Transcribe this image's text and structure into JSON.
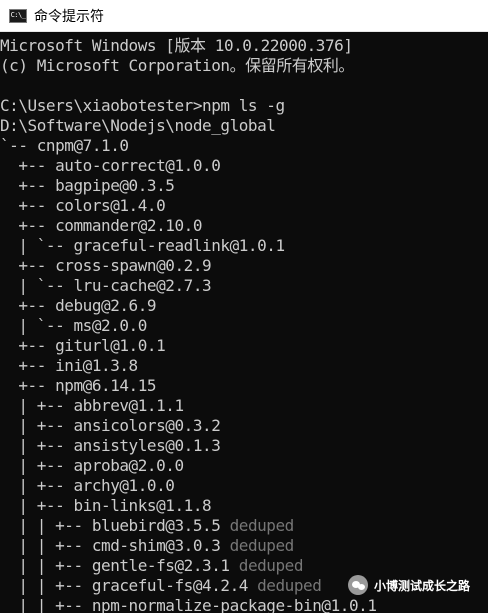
{
  "window": {
    "title": "命令提示符",
    "icon_label": "C:\\_",
    "icon_name": "cmd-icon"
  },
  "console_lines": [
    {
      "text": "Microsoft Windows [版本 10.0.22000.376]",
      "dim": ""
    },
    {
      "text": "(c) Microsoft Corporation。保留所有权利。",
      "dim": ""
    },
    {
      "text": "",
      "dim": ""
    },
    {
      "text": "C:\\Users\\xiaobotester>npm ls -g",
      "dim": ""
    },
    {
      "text": "D:\\Software\\Nodejs\\node_global",
      "dim": ""
    },
    {
      "text": "`-- cnpm@7.1.0",
      "dim": ""
    },
    {
      "text": "  +-- auto-correct@1.0.0",
      "dim": ""
    },
    {
      "text": "  +-- bagpipe@0.3.5",
      "dim": ""
    },
    {
      "text": "  +-- colors@1.4.0",
      "dim": ""
    },
    {
      "text": "  +-- commander@2.10.0",
      "dim": ""
    },
    {
      "text": "  | `-- graceful-readlink@1.0.1",
      "dim": ""
    },
    {
      "text": "  +-- cross-spawn@0.2.9",
      "dim": ""
    },
    {
      "text": "  | `-- lru-cache@2.7.3",
      "dim": ""
    },
    {
      "text": "  +-- debug@2.6.9",
      "dim": ""
    },
    {
      "text": "  | `-- ms@2.0.0",
      "dim": ""
    },
    {
      "text": "  +-- giturl@1.0.1",
      "dim": ""
    },
    {
      "text": "  +-- ini@1.3.8",
      "dim": ""
    },
    {
      "text": "  +-- npm@6.14.15",
      "dim": ""
    },
    {
      "text": "  | +-- abbrev@1.1.1",
      "dim": ""
    },
    {
      "text": "  | +-- ansicolors@0.3.2",
      "dim": ""
    },
    {
      "text": "  | +-- ansistyles@0.1.3",
      "dim": ""
    },
    {
      "text": "  | +-- aproba@2.0.0",
      "dim": ""
    },
    {
      "text": "  | +-- archy@1.0.0",
      "dim": ""
    },
    {
      "text": "  | +-- bin-links@1.1.8",
      "dim": ""
    },
    {
      "text": "  | | +-- bluebird@3.5.5",
      "dim": " deduped"
    },
    {
      "text": "  | | +-- cmd-shim@3.0.3",
      "dim": " deduped"
    },
    {
      "text": "  | | +-- gentle-fs@2.3.1",
      "dim": " deduped"
    },
    {
      "text": "  | | +-- graceful-fs@4.2.4",
      "dim": " deduped"
    },
    {
      "text": "  | | +-- npm-normalize-package-bin@1.0.1",
      "dim": ""
    }
  ],
  "watermark": {
    "text": "小博测试成长之路",
    "icon_name": "wechat-icon"
  },
  "colors": {
    "console_background": "#0c0c0c",
    "console_text": "#cccccc",
    "deduped_text": "#767676",
    "titlebar_background": "#ffffff"
  }
}
